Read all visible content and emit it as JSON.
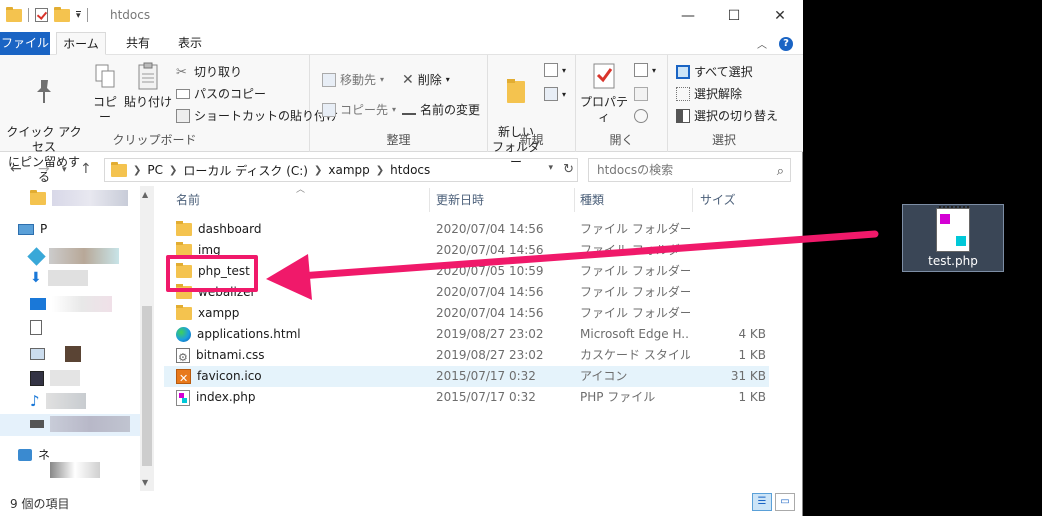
{
  "window": {
    "title": "htdocs",
    "controls": {
      "minimize": "—",
      "maximize": "☐",
      "close": "✕"
    }
  },
  "ribbon_tabs": {
    "file": "ファイル",
    "home": "ホーム",
    "share": "共有",
    "view": "表示"
  },
  "ribbon": {
    "clipboard": {
      "label": "クリップボード",
      "pin": "クイック アクセス\nにピン留めする",
      "copy": "コピー",
      "paste": "貼り付け",
      "cut": "切り取り",
      "copy_path": "パスのコピー",
      "paste_shortcut": "ショートカットの貼り付け"
    },
    "organize": {
      "label": "整理",
      "move_to": "移動先",
      "copy_to": "コピー先",
      "delete": "削除",
      "rename": "名前の変更"
    },
    "new": {
      "label": "新規",
      "new_folder": "新しい\nフォルダー"
    },
    "open": {
      "label": "開く",
      "properties": "プロパティ"
    },
    "select": {
      "label": "選択",
      "select_all": "すべて選択",
      "select_none": "選択解除",
      "invert": "選択の切り替え"
    }
  },
  "address": {
    "crumbs": [
      "PC",
      "ローカル ディスク (C:)",
      "xampp",
      "htdocs"
    ],
    "search_placeholder": "htdocsの検索"
  },
  "navpane": {
    "items": [
      {
        "label": ""
      },
      {
        "label": "P"
      },
      {
        "label": "ネ"
      }
    ]
  },
  "columns": {
    "name": "名前",
    "date": "更新日時",
    "type": "種類",
    "size": "サイズ"
  },
  "files": [
    {
      "name": "dashboard",
      "date": "2020/07/04 14:56",
      "type": "ファイル フォルダー",
      "size": "",
      "icon": "folder"
    },
    {
      "name": "img",
      "date": "2020/07/04 14:56",
      "type": "ファイル フォルダー",
      "size": "",
      "icon": "folder"
    },
    {
      "name": "php_test",
      "date": "2020/07/05 10:59",
      "type": "ファイル フォルダー",
      "size": "",
      "icon": "folder"
    },
    {
      "name": "webalizer",
      "date": "2020/07/04 14:56",
      "type": "ファイル フォルダー",
      "size": "",
      "icon": "folder"
    },
    {
      "name": "xampp",
      "date": "2020/07/04 14:56",
      "type": "ファイル フォルダー",
      "size": "",
      "icon": "folder"
    },
    {
      "name": "applications.html",
      "date": "2019/08/27 23:02",
      "type": "Microsoft Edge H...",
      "size": "4 KB",
      "icon": "edge"
    },
    {
      "name": "bitnami.css",
      "date": "2019/08/27 23:02",
      "type": "カスケード スタイル シ...",
      "size": "1 KB",
      "icon": "css"
    },
    {
      "name": "favicon.ico",
      "date": "2015/07/17 0:32",
      "type": "アイコン",
      "size": "31 KB",
      "icon": "ico"
    },
    {
      "name": "index.php",
      "date": "2015/07/17 0:32",
      "type": "PHP ファイル",
      "size": "1 KB",
      "icon": "php"
    }
  ],
  "status": {
    "count": "9 個の項目"
  },
  "desktop": {
    "icon_label": "test.php"
  },
  "colors": {
    "accent": "#1a64c4",
    "highlight": "#f0196a",
    "folder": "#f4c34f"
  }
}
